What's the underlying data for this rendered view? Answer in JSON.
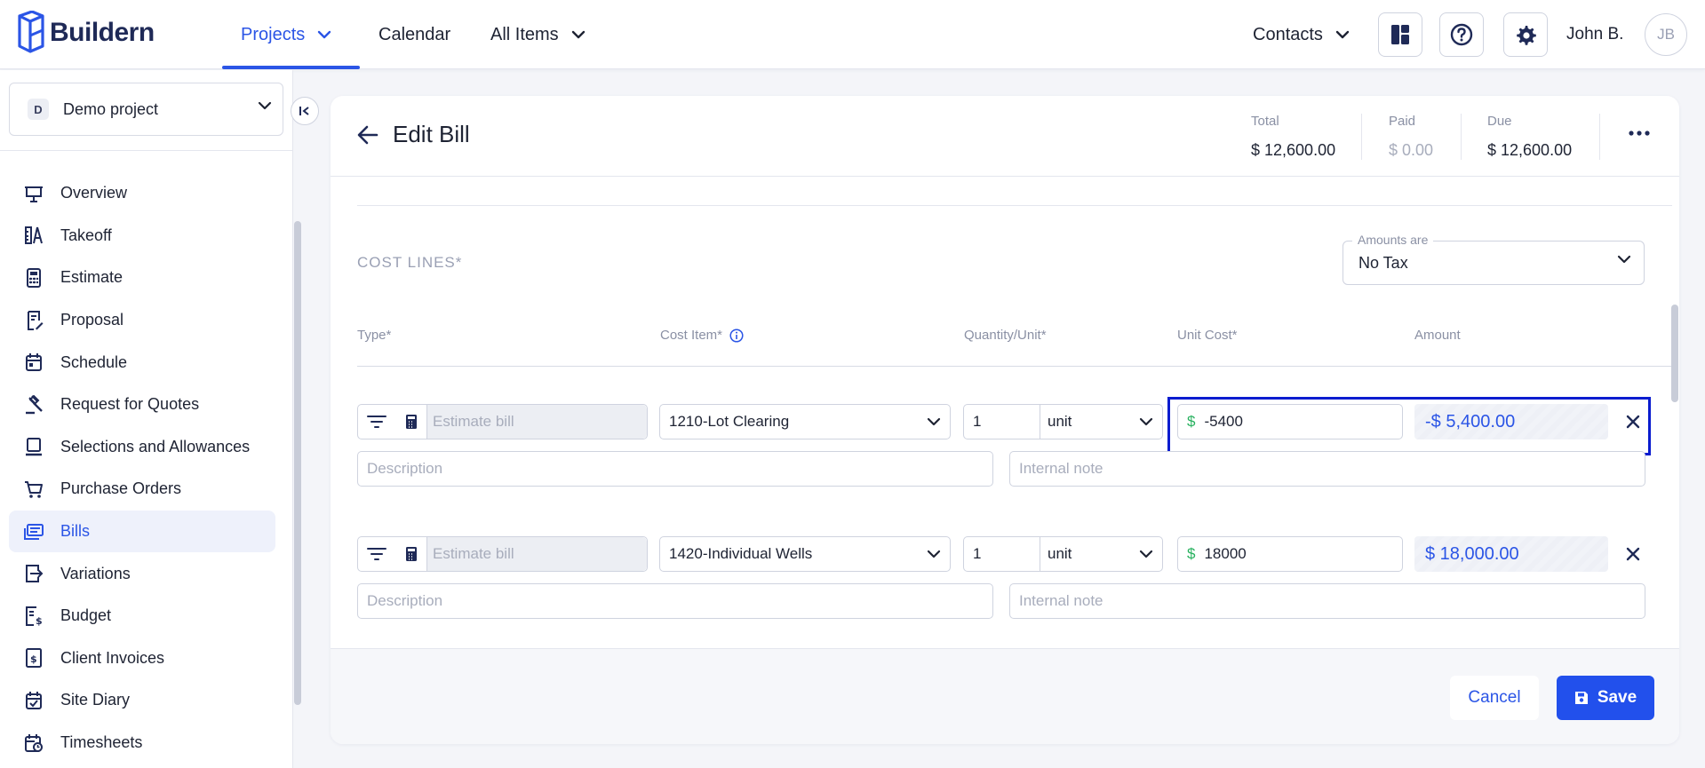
{
  "app": {
    "name": "Buildern"
  },
  "nav": {
    "projects": "Projects",
    "calendar": "Calendar",
    "all_items": "All Items",
    "contacts": "Contacts",
    "user_name": "John B.",
    "user_initials": "JB"
  },
  "sidebar": {
    "project_badge": "D",
    "project_name": "Demo project",
    "items": [
      {
        "label": "Overview",
        "icon": "presentation-board-icon"
      },
      {
        "label": "Takeoff",
        "icon": "ruler-compass-icon"
      },
      {
        "label": "Estimate",
        "icon": "calculator-icon"
      },
      {
        "label": "Proposal",
        "icon": "document-pen-icon"
      },
      {
        "label": "Schedule",
        "icon": "calendar-icon"
      },
      {
        "label": "Request for Quotes",
        "icon": "gavel-icon"
      },
      {
        "label": "Selections and Allowances",
        "icon": "selection-icon"
      },
      {
        "label": "Purchase Orders",
        "icon": "cart-icon"
      },
      {
        "label": "Bills",
        "icon": "bill-icon",
        "active": true
      },
      {
        "label": "Variations",
        "icon": "variation-icon"
      },
      {
        "label": "Budget",
        "icon": "budget-icon"
      },
      {
        "label": "Client Invoices",
        "icon": "invoice-icon"
      },
      {
        "label": "Site Diary",
        "icon": "diary-icon"
      },
      {
        "label": "Timesheets",
        "icon": "timesheet-icon"
      }
    ]
  },
  "header": {
    "title": "Edit Bill",
    "total_label": "Total",
    "total_value": "$ 12,600.00",
    "paid_label": "Paid",
    "paid_value": "$ 0.00",
    "due_label": "Due",
    "due_value": "$ 12,600.00"
  },
  "cost_lines": {
    "title": "COST LINES*",
    "amounts_label": "Amounts are",
    "amounts_value": "No Tax",
    "columns": {
      "type": "Type*",
      "cost_item": "Cost Item*",
      "quantity_unit": "Quantity/Unit*",
      "unit_cost": "Unit Cost*",
      "amount": "Amount"
    },
    "rows": [
      {
        "type_placeholder": "Estimate bill",
        "cost_item": "1210-Lot Clearing",
        "quantity": "1",
        "unit": "unit",
        "currency": "$",
        "unit_cost": "-5400",
        "amount": "-$ 5,400.00",
        "description_placeholder": "Description",
        "note_placeholder": "Internal note"
      },
      {
        "type_placeholder": "Estimate bill",
        "cost_item": "1420-Individual Wells",
        "quantity": "1",
        "unit": "unit",
        "currency": "$",
        "unit_cost": "18000",
        "amount": "$ 18,000.00",
        "description_placeholder": "Description",
        "note_placeholder": "Internal note"
      }
    ]
  },
  "footer": {
    "cancel": "Cancel",
    "save": "Save"
  },
  "colors": {
    "accent": "#2b55e6",
    "currency_green": "#27b15e",
    "highlight_border": "#0a1ccf"
  }
}
